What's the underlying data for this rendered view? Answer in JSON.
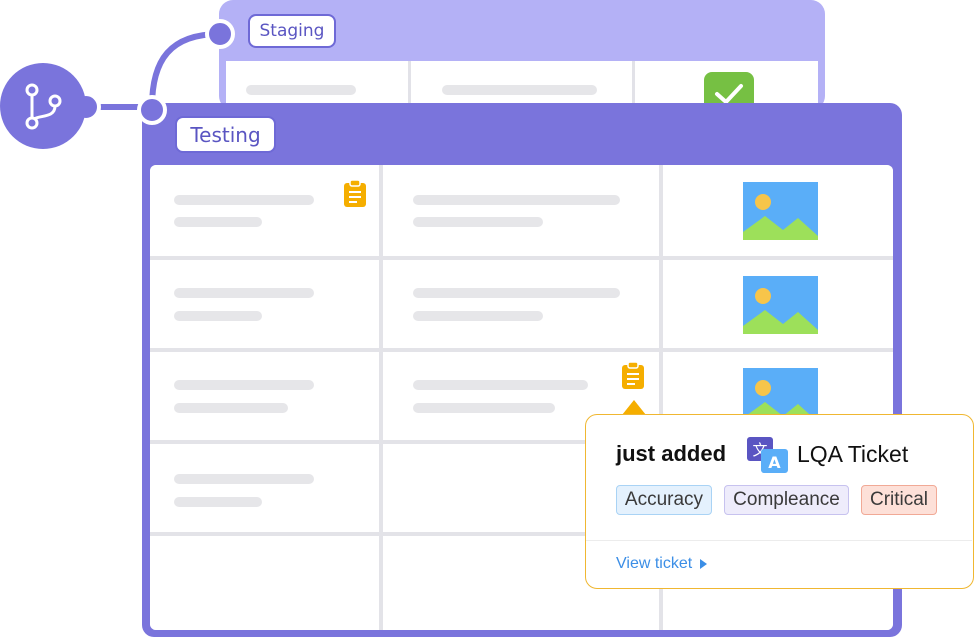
{
  "environments": {
    "staging_label": "Staging",
    "testing_label": "Testing"
  },
  "icons": {
    "branch": "git-branch-icon",
    "check": "check-icon",
    "clipboard": "clipboard-icon",
    "image": "image-placeholder-icon",
    "translate": "translate-icon",
    "caret": "caret-right-icon"
  },
  "colors": {
    "accent": "#7a74dc",
    "staging": "#b4b1f6",
    "check_green": "#76c043",
    "clipboard_orange": "#f5ae00",
    "link_blue": "#3b8ee6"
  },
  "popup": {
    "status": "just added",
    "title": "LQA Ticket",
    "tags": [
      "Accuracy",
      "Compleance",
      "Critical"
    ],
    "link": "View ticket"
  }
}
